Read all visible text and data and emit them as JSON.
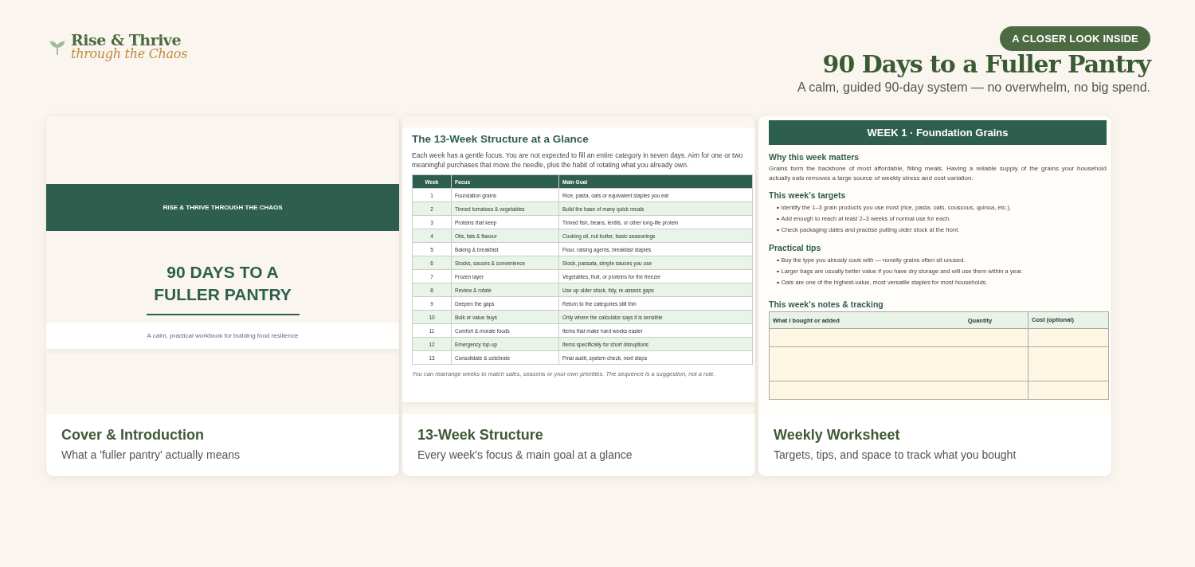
{
  "brand": {
    "name": "Rise & Thrive",
    "tagline": "through the Chaos"
  },
  "hero": {
    "badge": "A CLOSER LOOK INSIDE",
    "title": "90 Days to a Fuller Pantry",
    "subtitle": "A calm, guided 90-day system — no overwhelm, no big spend."
  },
  "cards": [
    {
      "kind": "cover",
      "title": "Cover & Introduction",
      "description": "What a 'fuller pantry' actually means",
      "preview": {
        "band": "RISE & THRIVE THROUGH THE CHAOS",
        "title_lines": [
          "90 DAYS TO A",
          "FULLER PANTRY"
        ],
        "subtitle": "A calm, practical workbook for building food resilience"
      }
    },
    {
      "kind": "structure",
      "title": "13-Week Structure",
      "description": "Every week's focus & main goal at a glance",
      "preview": {
        "heading": "The 13-Week Structure at a Glance",
        "intro": "Each week has a gentle focus. You are not expected to fill an entire category in seven days. Aim for one or two meaningful purchases that move the needle, plus the habit of rotating what you already own.",
        "columns": [
          "Week",
          "Focus",
          "Main Goal"
        ],
        "rows": [
          [
            "1",
            "Foundation grains",
            "Rice, pasta, oats or equivalent staples you eat"
          ],
          [
            "2",
            "Tinned tomatoes & vegetables",
            "Build the base of many quick meals"
          ],
          [
            "3",
            "Proteins that keep",
            "Tinned fish, beans, lentils, or other long-life protein"
          ],
          [
            "4",
            "Oils, fats & flavour",
            "Cooking oil, nut butter, basic seasonings"
          ],
          [
            "5",
            "Baking & breakfast",
            "Flour, raising agents, breakfast staples"
          ],
          [
            "6",
            "Stocks, sauces & convenience",
            "Stock, passata, simple sauces you use"
          ],
          [
            "7",
            "Frozen layer",
            "Vegetables, fruit, or proteins for the freezer"
          ],
          [
            "8",
            "Review & rotate",
            "Use up older stock, tidy, re-assess gaps"
          ],
          [
            "9",
            "Deepen the gaps",
            "Return to the categories still thin"
          ],
          [
            "10",
            "Bulk or value buys",
            "Only where the calculator says it is sensible"
          ],
          [
            "11",
            "Comfort & morale foods",
            "Items that make hard weeks easier"
          ],
          [
            "12",
            "Emergency top-up",
            "Items specifically for short disruptions"
          ],
          [
            "13",
            "Consolidate & celebrate",
            "Final audit, system check, next steps"
          ]
        ],
        "note": "You can rearrange weeks to match sales, seasons or your own priorities. The sequence is a suggestion, not a rule."
      }
    },
    {
      "kind": "worksheet",
      "title": "Weekly Worksheet",
      "description": "Targets, tips, and space to track what you bought",
      "preview": {
        "banner": "WEEK 1 · Foundation Grains",
        "sections": [
          {
            "heading": "Why this week matters",
            "paragraph": "Grains form the backbone of most affordable, filling meals. Having a reliable supply of the grains your household actually eats removes a large source of weekly stress and cost variation."
          },
          {
            "heading": "This week's targets",
            "bullets": [
              "Identify the 1–3 grain products you use most (rice, pasta, oats, couscous, quinoa, etc.).",
              "Add enough to reach at least 2–3 weeks of normal use for each.",
              "Check packaging dates and practise putting older stock at the front."
            ]
          },
          {
            "heading": "Practical tips",
            "bullets": [
              "Buy the type you already cook with — novelty grains often sit unused.",
              "Larger bags are usually better value if you have dry storage and will use them within a year.",
              "Oats are one of the highest-value, most versatile staples for most households."
            ]
          }
        ],
        "tracking_heading": "This week's notes & tracking",
        "tracking_columns": [
          "What I bought or added",
          "Quantity",
          "Cost (optional)"
        ]
      }
    }
  ]
}
